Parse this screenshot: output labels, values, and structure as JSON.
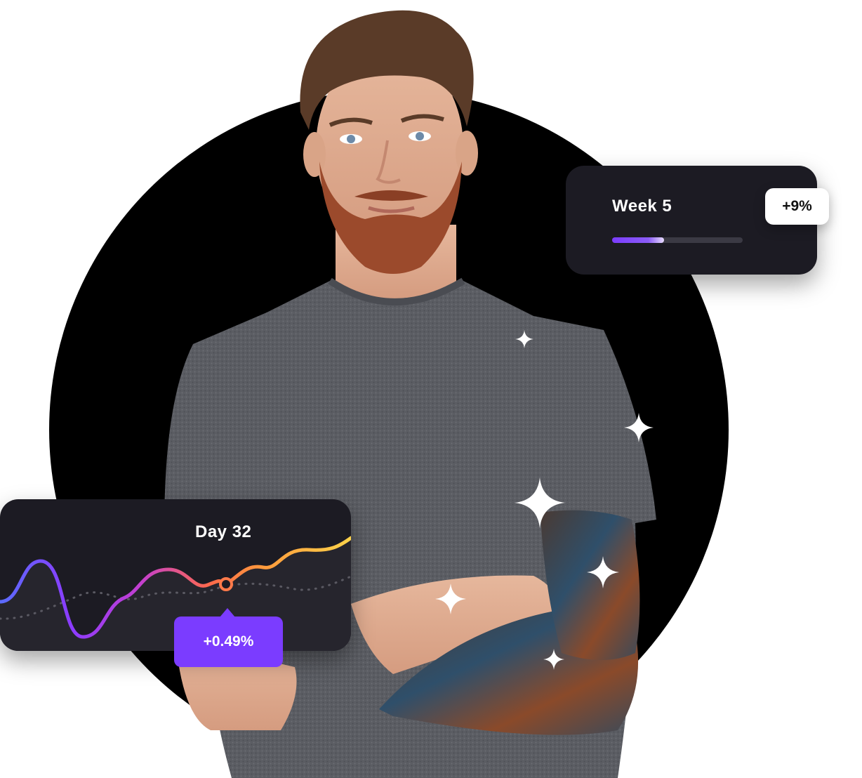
{
  "week_card": {
    "title": "Week 5",
    "progress": 0.4,
    "change": "+9%"
  },
  "day_card": {
    "title": "Day 32",
    "change": "+0.49%"
  },
  "colors": {
    "accent": "#7b3cff",
    "card_bg": "#1c1b23",
    "line_gradient": [
      "#5b6cff",
      "#8b3cff",
      "#c33fd0",
      "#ff6a4a",
      "#ff9a3c",
      "#ffd34a"
    ]
  },
  "decorations": [
    "sparkle-icon",
    "sparkle-icon",
    "sparkle-icon",
    "sparkle-icon",
    "sparkle-icon",
    "sparkle-icon"
  ]
}
